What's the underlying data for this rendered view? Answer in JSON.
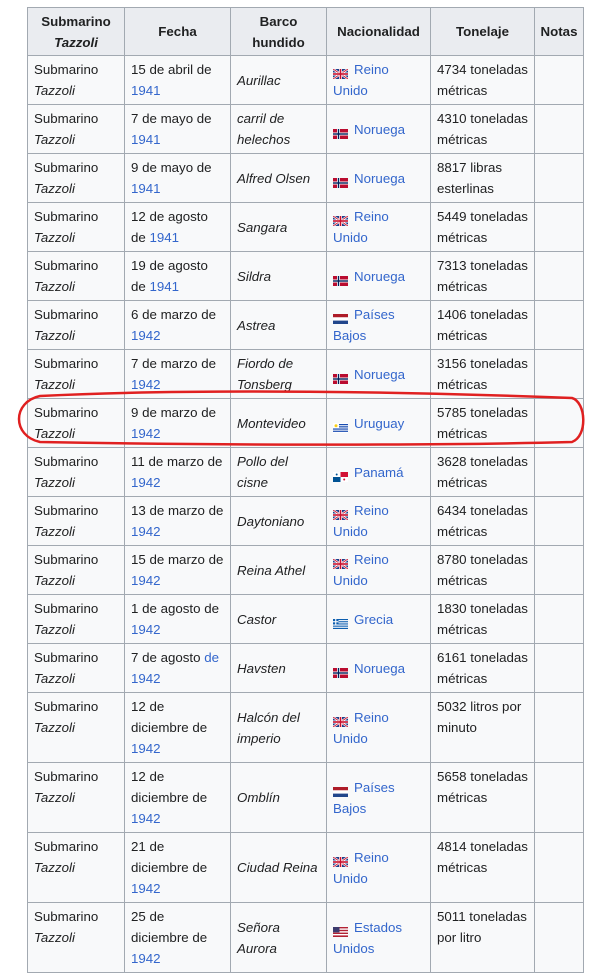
{
  "headers": {
    "submarine": "Submarino",
    "submarine_name": "Tazzoli",
    "date": "Fecha",
    "ship": "Barco hundido",
    "nationality": "Nacionalidad",
    "tonnage": "Tonelaje",
    "notes": "Notas"
  },
  "highlight_color": "#e02020",
  "rows": [
    {
      "sub": "Submarino",
      "sub_name": "Tazzoli",
      "date": "15 de abril de",
      "year": "1941",
      "ship": "Aurillac",
      "flag": "uk-flag",
      "nation": "Reino Unido",
      "tonnage": "4734 toneladas métricas"
    },
    {
      "sub": "Submarino",
      "sub_name": "Tazzoli",
      "date": "7 de mayo de",
      "year": "1941",
      "ship": "carril de helechos",
      "flag": "norway-flag",
      "nation": "Noruega",
      "tonnage": "4310 toneladas métricas"
    },
    {
      "sub": "Submarino",
      "sub_name": "Tazzoli",
      "date": "9 de mayo de",
      "year": "1941",
      "ship": "Alfred Olsen",
      "flag": "norway-flag",
      "nation": "Noruega",
      "tonnage": "8817 libras esterlinas"
    },
    {
      "sub": "Submarino",
      "sub_name": "Tazzoli",
      "date": "12 de agosto de",
      "year": "1941",
      "ship": "Sangara",
      "flag": "uk-flag",
      "nation": "Reino Unido",
      "tonnage": "5449 toneladas métricas"
    },
    {
      "sub": "Submarino",
      "sub_name": "Tazzoli",
      "date": "19 de agosto de",
      "year": "1941",
      "ship": "Sildra",
      "flag": "norway-flag",
      "nation": "Noruega",
      "tonnage": "7313 toneladas métricas"
    },
    {
      "sub": "Submarino",
      "sub_name": "Tazzoli",
      "date": "6 de marzo de",
      "year": "1942",
      "ship": "Astrea",
      "flag": "netherlands-flag",
      "nation": "Países Bajos",
      "tonnage": "1406 toneladas métricas"
    },
    {
      "sub": "Submarino",
      "sub_name": "Tazzoli",
      "date": "7 de marzo de",
      "year": "1942",
      "ship": "Fiordo de Tonsberg",
      "flag": "norway-flag",
      "nation": "Noruega",
      "tonnage": "3156 toneladas métricas"
    },
    {
      "sub": "Submarino",
      "sub_name": "Tazzoli",
      "date": "9 de marzo de",
      "year": "1942",
      "ship": "Montevideo",
      "flag": "uruguay-flag",
      "nation": "Uruguay",
      "tonnage": "5785 toneladas métricas"
    },
    {
      "sub": "Submarino",
      "sub_name": "Tazzoli",
      "date": "11 de marzo de",
      "year": "1942",
      "ship": "Pollo del cisne",
      "flag": "panama-flag",
      "nation": "Panamá",
      "tonnage": "3628 toneladas métricas"
    },
    {
      "sub": "Submarino",
      "sub_name": "Tazzoli",
      "date": "13 de marzo de",
      "year": "1942",
      "ship": "Daytoniano",
      "flag": "uk-flag",
      "nation": "Reino Unido",
      "tonnage": "6434 toneladas métricas"
    },
    {
      "sub": "Submarino",
      "sub_name": "Tazzoli",
      "date": "15 de marzo de",
      "year": "1942",
      "ship": "Reina Athel",
      "flag": "uk-flag",
      "nation": "Reino Unido",
      "tonnage": "8780 toneladas métricas"
    },
    {
      "sub": "Submarino",
      "sub_name": "Tazzoli",
      "date": "1 de agosto de",
      "year": "1942",
      "ship": "Castor",
      "flag": "greece-flag",
      "nation": "Grecia",
      "tonnage": "1830 toneladas métricas"
    },
    {
      "sub": "Submarino",
      "sub_name": "Tazzoli",
      "date": "7 de agosto",
      "date_link": "de",
      "year": "1942",
      "ship": "Havsten",
      "flag": "norway-flag",
      "nation": "Noruega",
      "tonnage": "6161 toneladas métricas"
    },
    {
      "sub": "Submarino",
      "sub_name": "Tazzoli",
      "date": "12 de diciembre de",
      "year": "1942",
      "ship": "Halcón del imperio",
      "flag": "uk-flag",
      "nation": "Reino Unido",
      "tonnage": "5032 litros por minuto"
    },
    {
      "sub": "Submarino",
      "sub_name": "Tazzoli",
      "date": "12 de diciembre de",
      "year": "1942",
      "ship": "Omblín",
      "flag": "netherlands-flag",
      "nation": "Países Bajos",
      "tonnage": "5658 toneladas métricas"
    },
    {
      "sub": "Submarino",
      "sub_name": "Tazzoli",
      "date": "21 de diciembre de",
      "year": "1942",
      "ship": "Ciudad Reina",
      "flag": "uk-flag",
      "nation": "Reino Unido",
      "tonnage": "4814 toneladas métricas"
    },
    {
      "sub": "Submarino",
      "sub_name": "Tazzoli",
      "date": "25 de diciembre de",
      "year": "1942",
      "ship": "Señora Aurora",
      "flag": "usa-flag",
      "nation": "Estados Unidos",
      "tonnage": "5011 toneladas por litro"
    }
  ]
}
